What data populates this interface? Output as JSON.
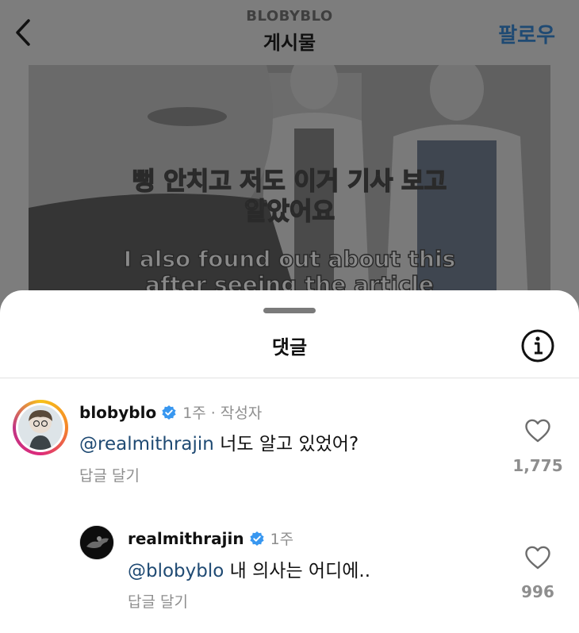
{
  "header": {
    "account": "BLOBYBLO",
    "title": "게시물",
    "follow_label": "팔로우"
  },
  "video": {
    "subtitle_ko_line1": "뻥 안치고 저도 이거 기사 보고",
    "subtitle_ko_line2": "알았어요",
    "subtitle_en_line1": "I also found out about this",
    "subtitle_en_line2": "after seeing the article"
  },
  "sheet": {
    "title": "댓글"
  },
  "comments": [
    {
      "username": "blobyblo",
      "time": "1주",
      "author_tag": "· 작성자",
      "mention": "@realmithrajin",
      "text": " 너도 알고 있었어?",
      "reply_label": "답글 달기",
      "likes": "1,775"
    },
    {
      "username": "realmithrajin",
      "time": "1주",
      "mention": "@blobyblo",
      "text": " 내 의사는 어디에..",
      "reply_label": "답글 달기",
      "likes": "996"
    }
  ],
  "colors": {
    "mention": "#1f4a73",
    "verified": "#3897f0",
    "meta": "#8e8e8e",
    "dim_overlay": "#7d7d7d"
  },
  "icons": {
    "back": "chevron-left-icon",
    "info": "info-icon",
    "like": "heart-icon",
    "verified": "verified-badge-icon"
  }
}
